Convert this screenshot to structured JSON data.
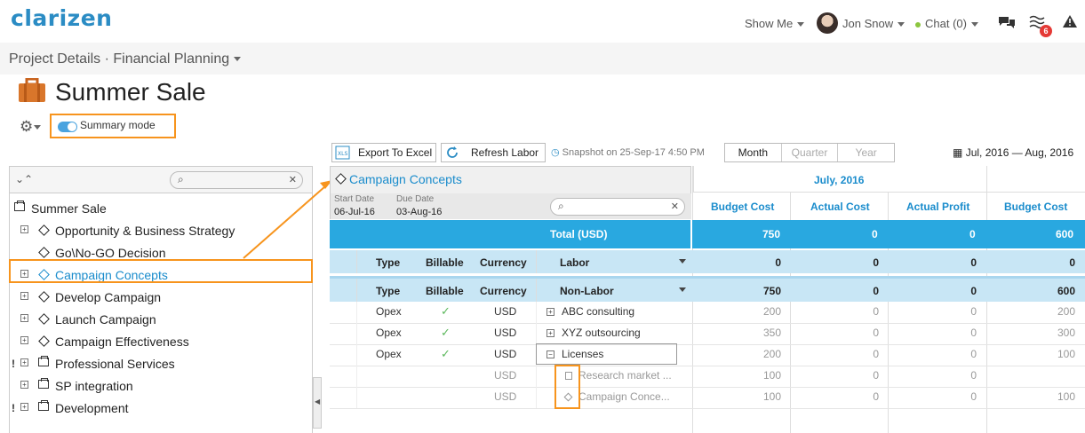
{
  "topbar": {
    "logo": "clarizen",
    "show_me": "Show Me",
    "user_name": "Jon Snow",
    "chat": "Chat (0)",
    "notification_count": "6"
  },
  "breadcrumb": "Project Details · Financial Planning",
  "page_title": "Summer Sale",
  "summary_mode": "Summary mode",
  "toolbar": {
    "export": "Export To Excel",
    "refresh": "Refresh Labor",
    "snapshot": "Snapshot on 25-Sep-17 4:50 PM",
    "periods": [
      "Month",
      "Quarter",
      "Year"
    ],
    "date_range": "Jul, 2016 — Aug, 2016"
  },
  "tree": {
    "root": "Summer Sale",
    "items": [
      {
        "label": "Opportunity & Business Strategy",
        "type": "milestone",
        "expand": true,
        "flag": false
      },
      {
        "label": "Go\\No-GO Decision",
        "type": "milestone",
        "expand": false,
        "flag": false
      },
      {
        "label": "Campaign Concepts",
        "type": "milestone",
        "expand": true,
        "flag": false,
        "selected": true
      },
      {
        "label": "Develop Campaign",
        "type": "milestone",
        "expand": true,
        "flag": false
      },
      {
        "label": "Launch Campaign",
        "type": "milestone",
        "expand": true,
        "flag": false
      },
      {
        "label": "Campaign Effectiveness",
        "type": "milestone",
        "expand": true,
        "flag": false
      },
      {
        "label": "Professional Services",
        "type": "project",
        "expand": true,
        "flag": true
      },
      {
        "label": "SP integration",
        "type": "project",
        "expand": true,
        "flag": false
      },
      {
        "label": "Development",
        "type": "project",
        "expand": true,
        "flag": true
      }
    ]
  },
  "detail": {
    "name": "Campaign Concepts",
    "start_label": "Start Date",
    "start_value": "06-Jul-16",
    "due_label": "Due Date",
    "due_value": "03-Aug-16"
  },
  "grid": {
    "month": "July, 2016",
    "columns": [
      "Budget Cost",
      "Actual Cost",
      "Actual Profit",
      "Budget Cost"
    ],
    "total_label": "Total (USD)",
    "total_values": [
      "750",
      "0",
      "0",
      "600"
    ],
    "sub_headers": [
      "Type",
      "Billable",
      "Currency"
    ],
    "labor": {
      "label": "Labor",
      "values": [
        "0",
        "0",
        "0",
        "0"
      ]
    },
    "nonlabor": {
      "label": "Non-Labor",
      "values": [
        "750",
        "0",
        "0",
        "600"
      ]
    },
    "rows": [
      {
        "type": "Opex",
        "billable": "✓",
        "currency": "USD",
        "name": "ABC consulting",
        "values": [
          "200",
          "0",
          "0",
          "200"
        ]
      },
      {
        "type": "Opex",
        "billable": "✓",
        "currency": "USD",
        "name": "XYZ outsourcing",
        "values": [
          "350",
          "0",
          "0",
          "300"
        ]
      },
      {
        "type": "Opex",
        "billable": "✓",
        "currency": "USD",
        "name": "Licenses",
        "values": [
          "200",
          "0",
          "0",
          "100"
        ]
      },
      {
        "type": "",
        "billable": "",
        "currency": "USD",
        "name": "Research market ...",
        "values": [
          "100",
          "0",
          "0",
          ""
        ]
      },
      {
        "type": "",
        "billable": "",
        "currency": "USD",
        "name": "Campaign Conce...",
        "values": [
          "100",
          "0",
          "0",
          "100"
        ]
      }
    ]
  },
  "colors": {
    "accent": "#1a8ccc",
    "total_bar": "#29a8e0",
    "highlight": "#f7941d",
    "subheader": "#c8e6f5"
  }
}
